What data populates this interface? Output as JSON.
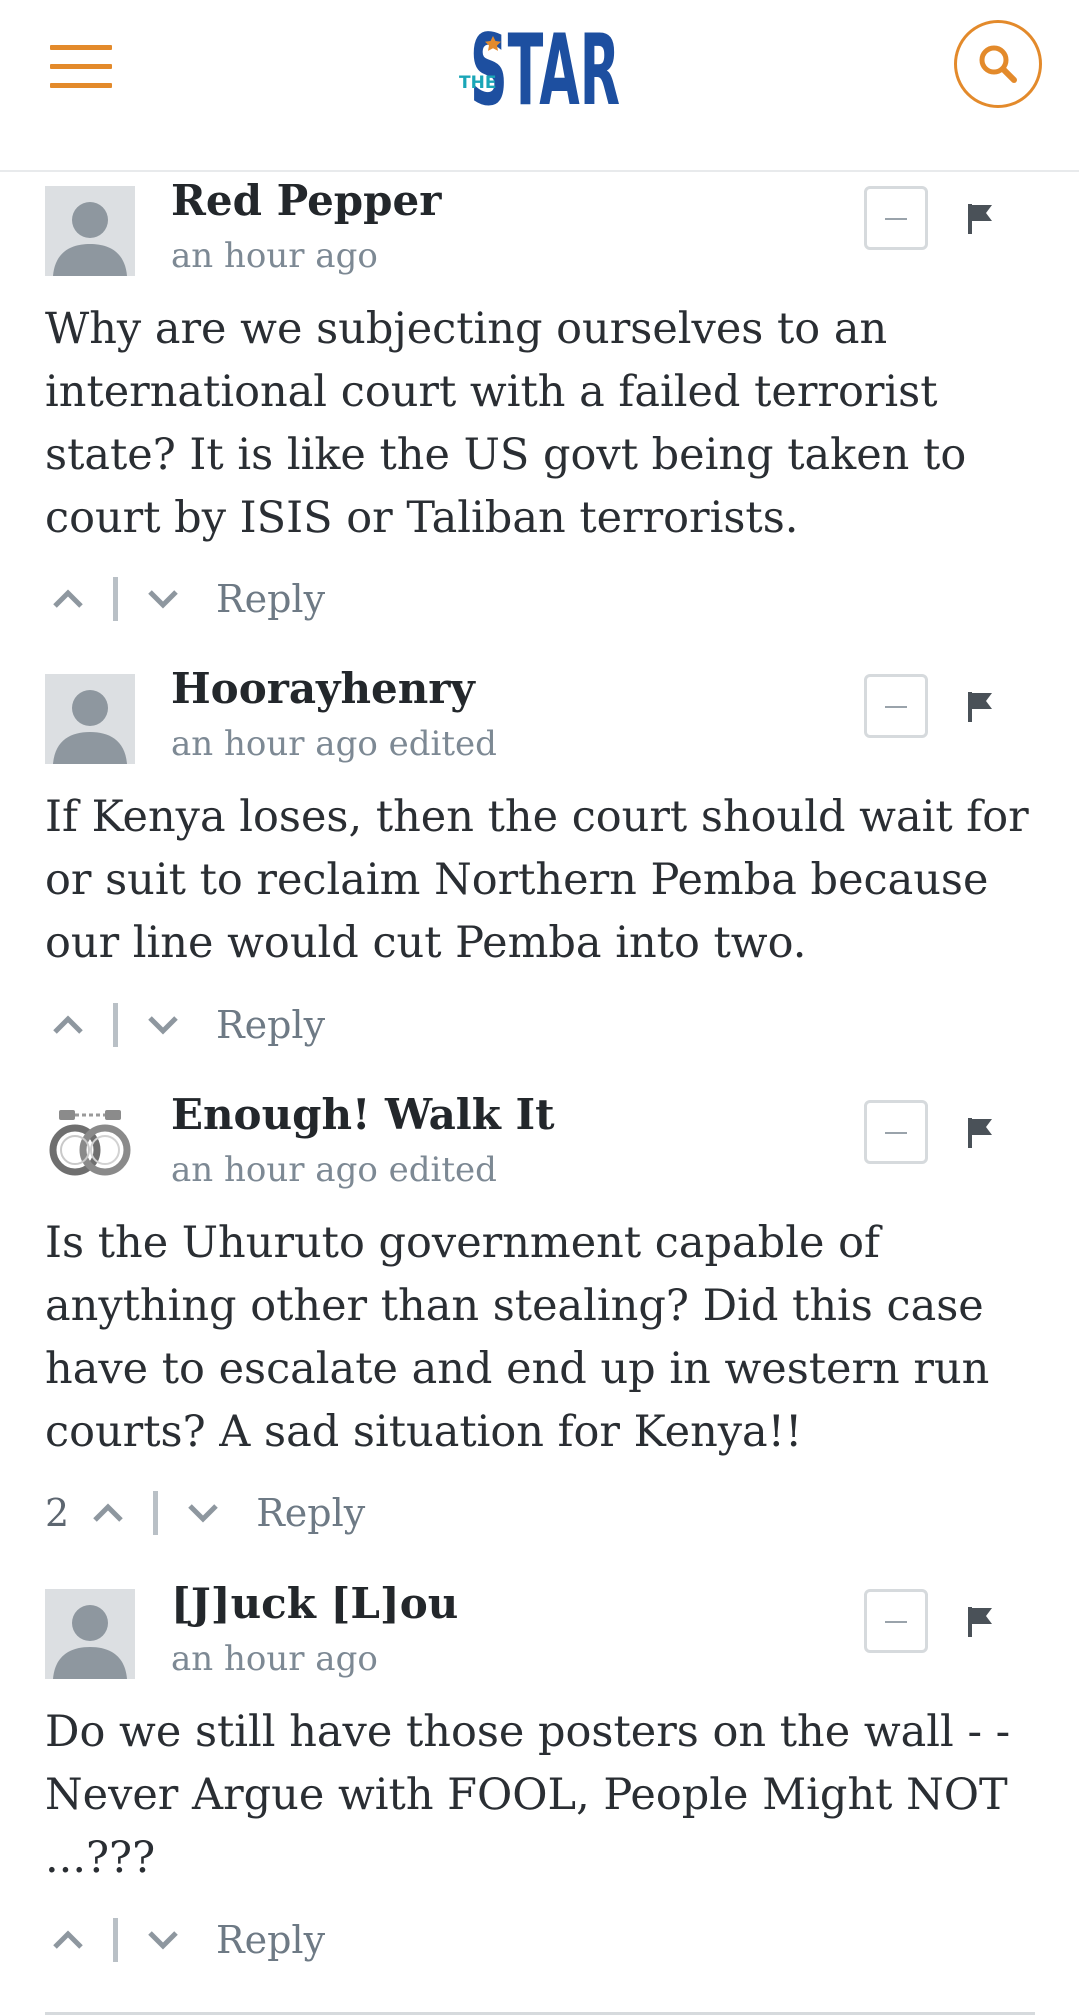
{
  "header": {
    "logo_small": "THE",
    "logo_main": "STAR",
    "colors": {
      "accent": "#e38a2b",
      "brand_blue": "#1d4fa0",
      "brand_teal": "#1aa6b7"
    }
  },
  "comments": [
    {
      "author": "Red Pepper",
      "meta": "an hour ago",
      "body": "Why are we subjecting ourselves to an international court with a failed terrorist state? It is like the US govt being taken to court by ISIS or Taliban terrorists.",
      "votes": "",
      "reply_label": "Reply",
      "avatar": "default-avatar"
    },
    {
      "author": "Hoorayhenry",
      "meta": "an hour ago edited",
      "body": "If Kenya loses, then the court should wait for or suit to reclaim Northern Pemba because our line would cut Pemba into two.",
      "votes": "",
      "reply_label": "Reply",
      "avatar": "default-avatar"
    },
    {
      "author": "Enough! Walk It",
      "meta": "an hour ago edited",
      "body": "Is the Uhuruto government capable of anything other than stealing? Did this case have to escalate and end up in western run courts? A sad situation for Kenya!!",
      "votes": "2",
      "reply_label": "Reply",
      "avatar": "handcuffs-avatar"
    },
    {
      "author": "[J]uck [L]ou",
      "meta": "an hour ago",
      "body": "Do we still have those posters on the wall - - Never Argue with FOOL, People Might NOT ...???",
      "votes": "",
      "reply_label": "Reply",
      "avatar": "default-avatar"
    }
  ]
}
